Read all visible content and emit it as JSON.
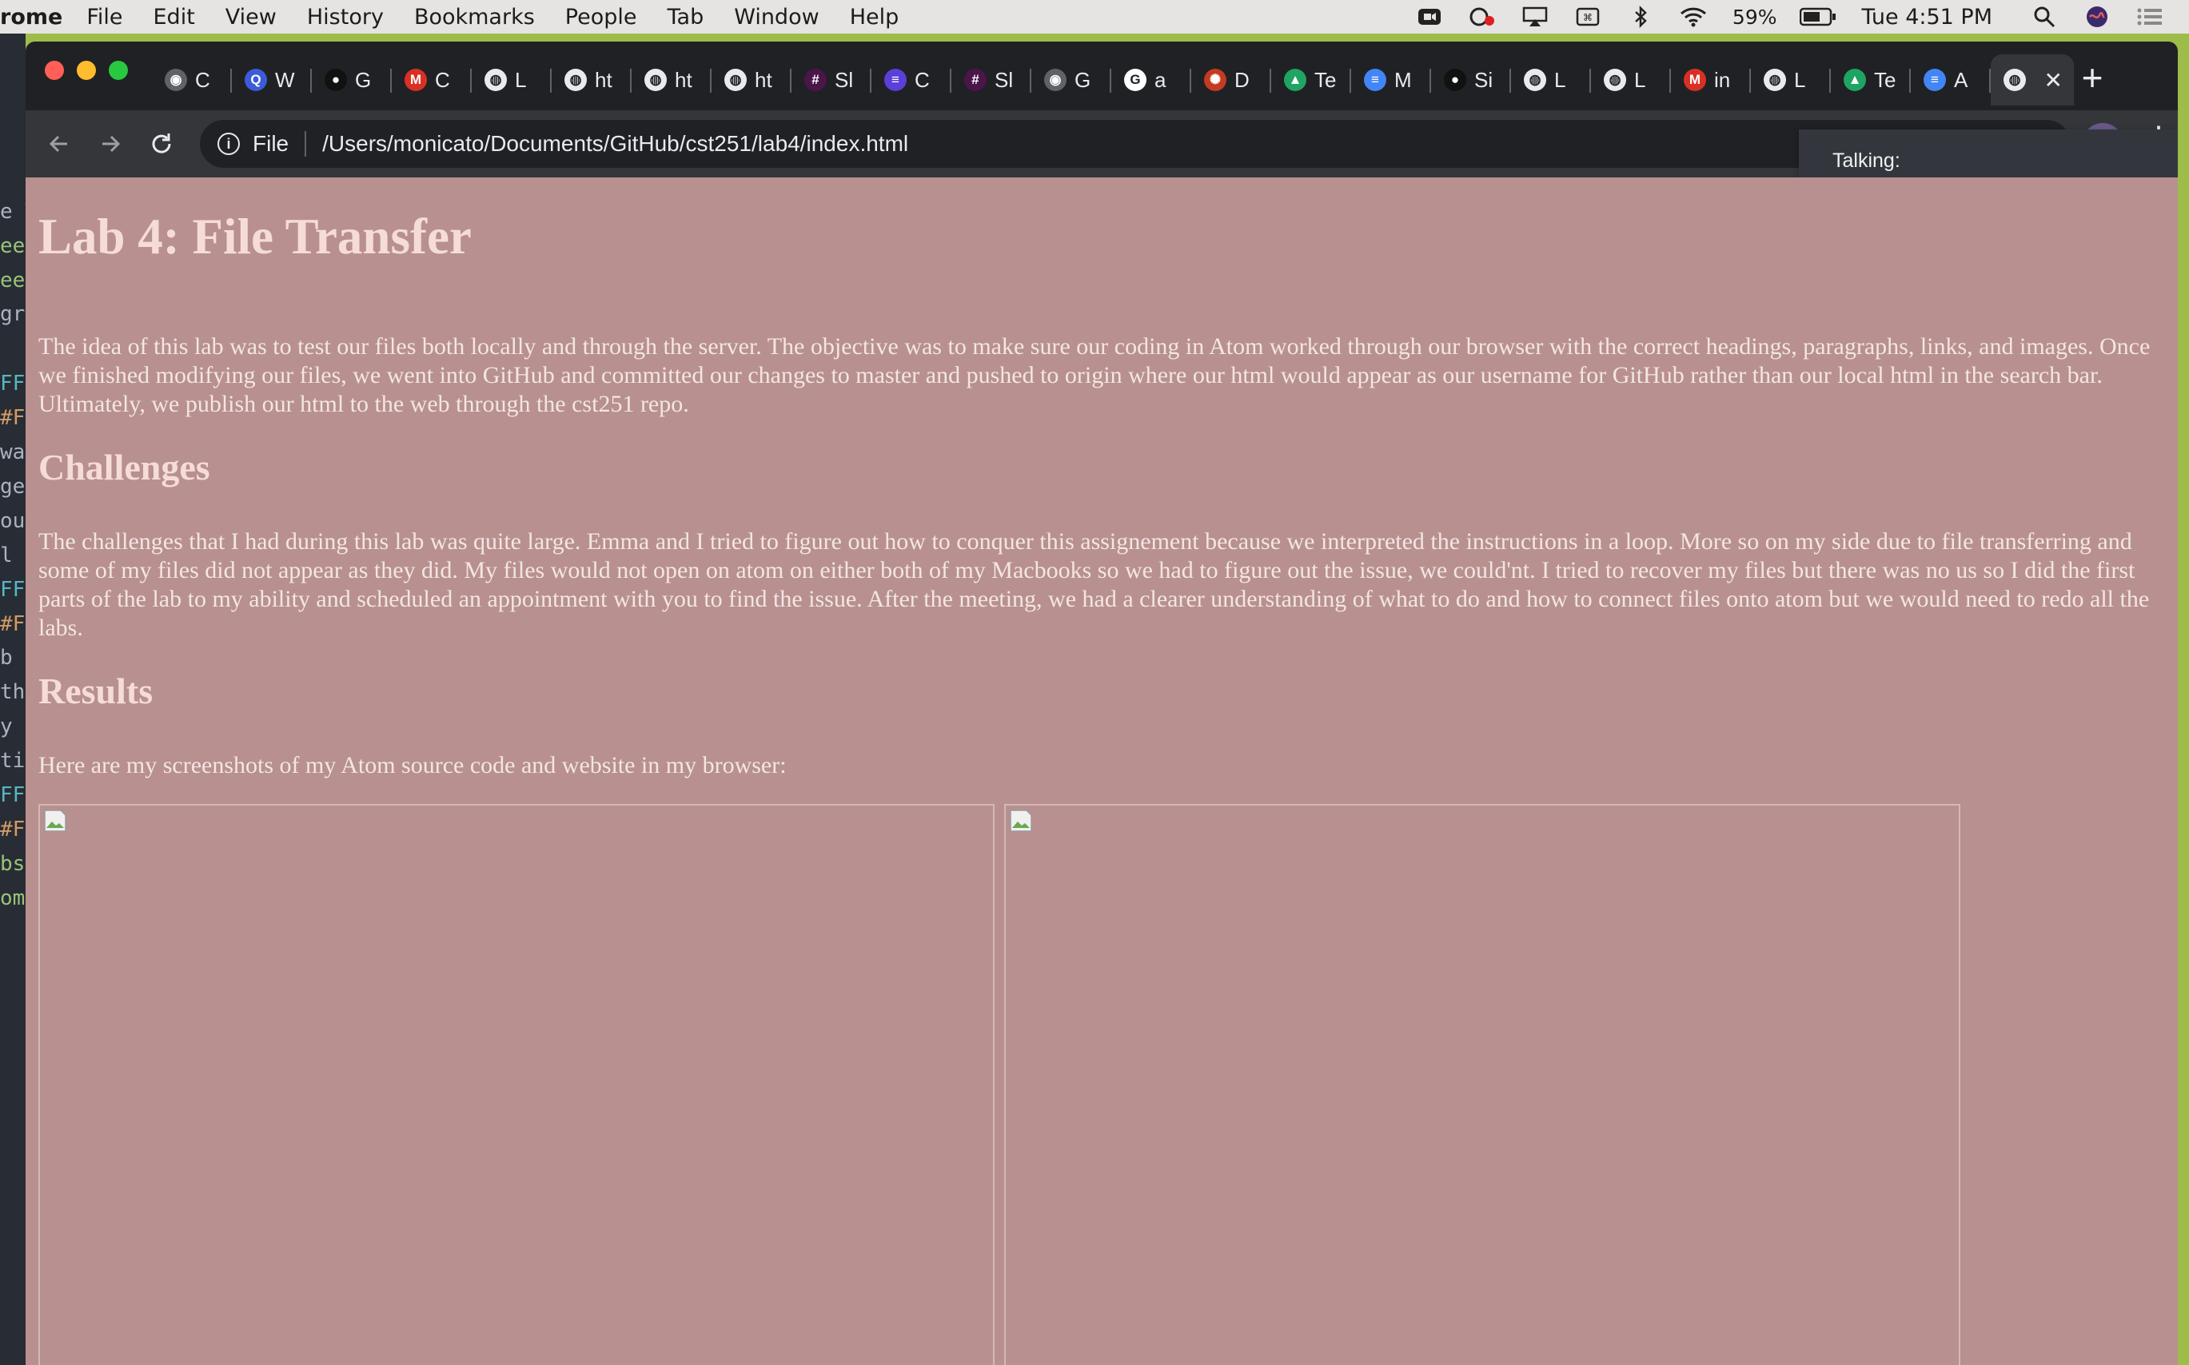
{
  "menubar": {
    "app_name": "rome",
    "items": [
      "File",
      "Edit",
      "View",
      "History",
      "Bookmarks",
      "People",
      "Tab",
      "Window",
      "Help"
    ],
    "battery": "59%",
    "clock": "Tue 4:51 PM"
  },
  "editor": {
    "lines": [
      "e T",
      "ee",
      "ee",
      "gr",
      "FF",
      "#F",
      "wa",
      "ge",
      "ou",
      "l ",
      "FF",
      "#F",
      " b",
      "th",
      "y ",
      "ti",
      "FF",
      "#F",
      "bs",
      "om"
    ]
  },
  "tabs": [
    {
      "icon": "site-icon",
      "label": "C",
      "color": "#5f6368",
      "glyph": "◉"
    },
    {
      "icon": "q-icon",
      "label": "W",
      "color": "#3c5bd9",
      "glyph": "Q"
    },
    {
      "icon": "github-icon",
      "label": "G",
      "color": "#111111",
      "glyph": "●"
    },
    {
      "icon": "gmail-icon",
      "label": "C",
      "color": "#d93025",
      "glyph": "M"
    },
    {
      "icon": "globe-icon",
      "label": "L",
      "color": "#e8eaed",
      "glyph": "◍"
    },
    {
      "icon": "globe-icon",
      "label": "ht",
      "color": "#e8eaed",
      "glyph": "◍"
    },
    {
      "icon": "globe-icon",
      "label": "ht",
      "color": "#e8eaed",
      "glyph": "◍"
    },
    {
      "icon": "globe-icon",
      "label": "ht",
      "color": "#e8eaed",
      "glyph": "◍"
    },
    {
      "icon": "slack-icon",
      "label": "Sl",
      "color": "#4a154b",
      "glyph": "#"
    },
    {
      "icon": "list-icon",
      "label": "C",
      "color": "#5b3fd9",
      "glyph": "≡"
    },
    {
      "icon": "slack-icon",
      "label": "Sl",
      "color": "#4a154b",
      "glyph": "#"
    },
    {
      "icon": "site-icon",
      "label": "G",
      "color": "#5f6368",
      "glyph": "◉"
    },
    {
      "icon": "google-icon",
      "label": "a",
      "color": "#ffffff",
      "glyph": "G"
    },
    {
      "icon": "csusb-icon",
      "label": "D",
      "color": "#c23b22",
      "glyph": "✺"
    },
    {
      "icon": "drive-icon",
      "label": "Te",
      "color": "#1fa463",
      "glyph": "▲"
    },
    {
      "icon": "docs-icon",
      "label": "M",
      "color": "#4285f4",
      "glyph": "≡"
    },
    {
      "icon": "github-icon",
      "label": "Si",
      "color": "#111111",
      "glyph": "●"
    },
    {
      "icon": "globe-icon",
      "label": "L",
      "color": "#e8eaed",
      "glyph": "◍"
    },
    {
      "icon": "globe-icon",
      "label": "L",
      "color": "#e8eaed",
      "glyph": "◍"
    },
    {
      "icon": "gmail-icon",
      "label": "in",
      "color": "#d93025",
      "glyph": "M"
    },
    {
      "icon": "globe-icon",
      "label": "L",
      "color": "#e8eaed",
      "glyph": "◍"
    },
    {
      "icon": "drive-icon",
      "label": "Te",
      "color": "#1fa463",
      "glyph": "▲"
    },
    {
      "icon": "docs-icon",
      "label": "A",
      "color": "#4285f4",
      "glyph": "≡"
    },
    {
      "icon": "globe-icon",
      "label": "",
      "color": "#e8eaed",
      "glyph": "◍",
      "active": true
    }
  ],
  "omnibox": {
    "scheme": "File",
    "url": "/Users/monicato/Documents/GitHub/cst251/lab4/index.html"
  },
  "popup": {
    "text": "Talking:"
  },
  "page": {
    "title": "Lab 4: File Transfer",
    "intro": "The idea of this lab was to test our files both locally and through the server. The objective was to make sure our coding in Atom worked through our browser with the correct headings, paragraphs, links, and images. Once we finished modifying our files, we went into GitHub and committed our changes to master and pushed to origin where our html would appear as our username for GitHub rather than our local html in the search bar. Ultimately, we publish our html to the web through the cst251 repo.",
    "challenges_heading": "Challenges",
    "challenges_text": "The challenges that I had during this lab was quite large. Emma and I tried to figure out how to conquer this assignement because we interpreted the instructions in a loop. More so on my side due to file transferring and some of my files did not appear as they did. My files would not open on atom on either both of my Macbooks so we had to figure out the issue, we could'nt. I tried to recover my files but there was no us so I did the first parts of the lab to my ability and scheduled an appointment with you to find the issue. After the meeting, we had a clearer understanding of what to do and how to connect files onto atom but we would need to redo all the labs.",
    "results_heading": "Results",
    "results_text": "Here are my screenshots of my Atom source code and website in my browser:"
  },
  "colors": {
    "page_bg": "#b89090",
    "heading": "#f6dcd6",
    "tab_strip": "#202124",
    "toolbar": "#35363a"
  }
}
